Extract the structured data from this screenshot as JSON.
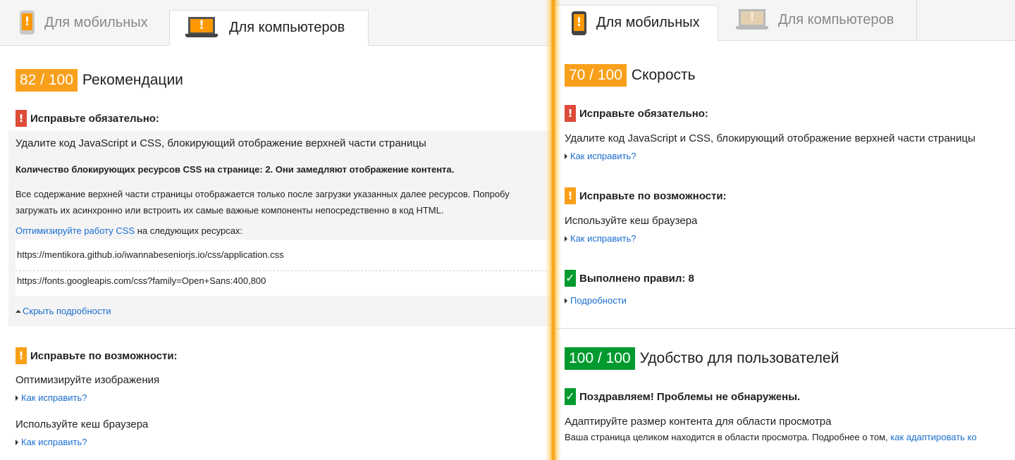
{
  "left": {
    "tabs": [
      {
        "label": "Для мобильных",
        "icon": "phone-icon",
        "active": false
      },
      {
        "label": "Для компьютеров",
        "icon": "laptop-icon",
        "active": true
      }
    ],
    "score": "82 / 100",
    "score_title": "Рекомендации",
    "must_fix": {
      "heading": "Исправьте обязательно:",
      "rule_title": "Удалите код JavaScript и CSS, блокирующий отображение верхней части страницы",
      "summary": "Количество блокирующих ресурсов CSS на странице: 2. Они замедляют отображение контента.",
      "description_line1": "Все содержание верхней части страницы отображается только после загрузки указанных далее ресурсов. Попробу",
      "description_line2": "загружать их асинхронно или встроить их самые важные компоненты непосредственно в код HTML.",
      "optimize_link": "Оптимизируйте работу CSS",
      "optimize_suffix": " на следующих ресурсах:",
      "resources": [
        "https://mentikora.github.io/iwannabeseniorjs.io/css/application.css",
        "https://fonts.googleapis.com/css?family=Open+Sans:400,800"
      ],
      "hide_details": "Скрыть подробности"
    },
    "should_fix": {
      "heading": "Исправьте по возможности:",
      "items": [
        {
          "title": "Оптимизируйте изображения",
          "link": "Как исправить?"
        },
        {
          "title": "Используйте кеш браузера",
          "link": "Как исправить?"
        }
      ]
    }
  },
  "right": {
    "tabs": [
      {
        "label": "Для мобильных",
        "icon": "phone-icon",
        "active": true
      },
      {
        "label": "Для компьютеров",
        "icon": "laptop-icon",
        "active": false
      }
    ],
    "speed": {
      "score": "70 / 100",
      "title": "Скорость",
      "must_fix_heading": "Исправьте обязательно:",
      "must_fix_rule": "Удалите код JavaScript и CSS, блокирующий отображение верхней части страницы",
      "must_fix_link": "Как исправить?",
      "should_fix_heading": "Исправьте по возможности:",
      "should_fix_rule": "Используйте кеш браузера",
      "should_fix_link": "Как исправить?",
      "passed_heading": "Выполнено правил: 8",
      "passed_link": "Подробности"
    },
    "usability": {
      "score": "100 / 100",
      "title": "Удобство для пользователей",
      "congrats": "Поздравляем! Проблемы не обнаружены.",
      "rule_title": "Адаптируйте размер контента для области просмотра",
      "rule_desc": "Ваша страница целиком находится в области просмотра. Подробнее о том, ",
      "rule_link": "как адаптировать ко"
    }
  },
  "colors": {
    "orange": "#f9a01b",
    "green": "#009a2e",
    "red": "#dd4b39",
    "link": "#1a6ecf",
    "divider": "#f79a00"
  }
}
